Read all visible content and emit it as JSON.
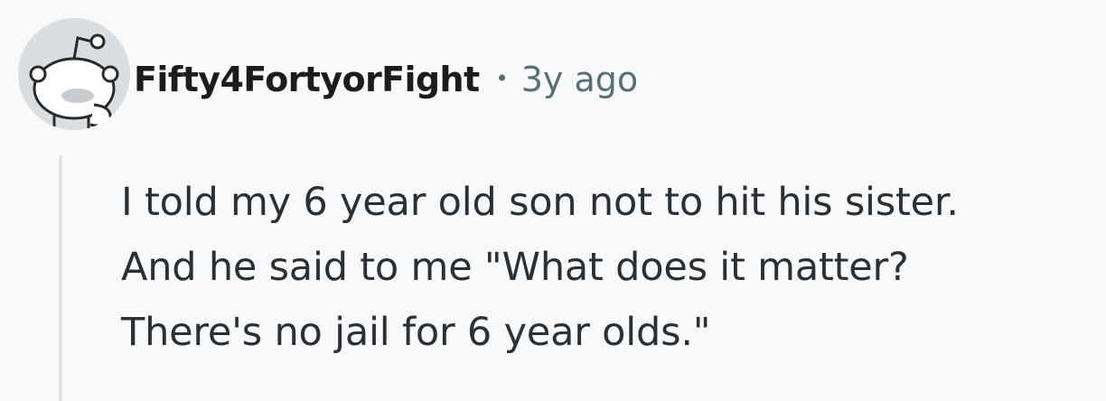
{
  "comment": {
    "author": {
      "username": "Fifty4FortyorFight",
      "avatar_icon": "reddit-snoo-default-avatar-icon"
    },
    "separator": "•",
    "timestamp": "3y ago",
    "body_lines": [
      "I told my 6 year old son not to hit his sister.",
      "And he said to me \"What does it matter?",
      "There's no jail for 6 year olds.\""
    ]
  },
  "colors": {
    "background": "#f7f9fa",
    "username": "#1c1c1c",
    "meta_text": "#576f76",
    "body_text": "#2a3136",
    "thread_line": "#dfe4e8",
    "avatar_bg": "#d9dee2"
  }
}
